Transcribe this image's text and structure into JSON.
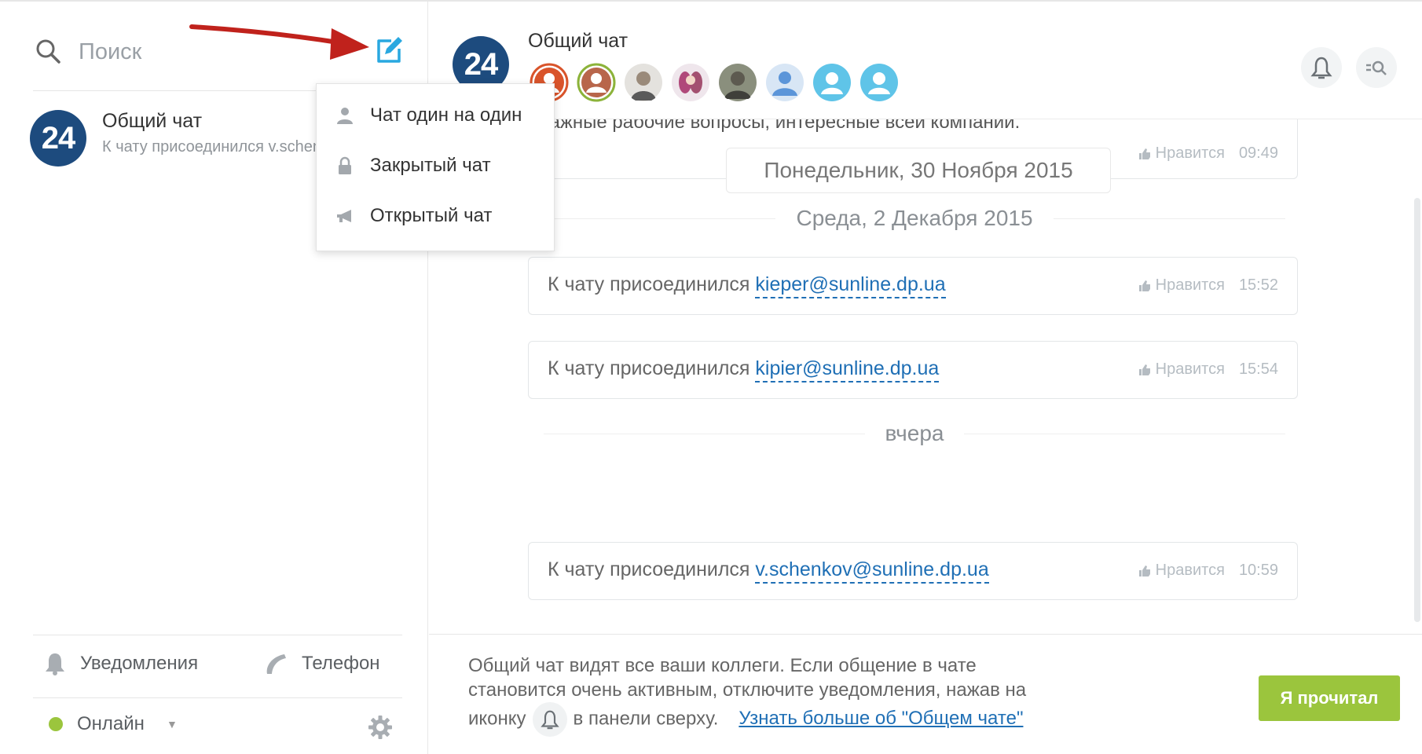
{
  "sidebar": {
    "search_placeholder": "Поиск",
    "chat": {
      "badge": "24",
      "name": "Общий чат",
      "preview": "К чату присоединился v.schenkov@sunline.dp.ua"
    },
    "notifications_label": "Уведомления",
    "phone_label": "Телефон",
    "status_label": "Онлайн",
    "status_color": "#9bc53d"
  },
  "menu": {
    "items": [
      {
        "label": "Чат один на один",
        "icon": "user-icon"
      },
      {
        "label": "Закрытый чат",
        "icon": "lock-icon"
      },
      {
        "label": "Открытый чат",
        "icon": "megaphone-icon"
      }
    ]
  },
  "header": {
    "badge": "24",
    "title": "Общий чат",
    "participant_count": 8
  },
  "messages": {
    "top_text": "важные рабочие вопросы, интересные всей компании.",
    "top_date_pill": "Понедельник, 30 Ноября 2015",
    "top_like": "Нравится",
    "top_time": "09:49",
    "sep1": "Среда, 2 Декабря 2015",
    "sep2": "вчера",
    "items": [
      {
        "text": "К чату присоединился ",
        "user": "kieper@sunline.dp.ua",
        "like": "Нравится",
        "time": "15:52"
      },
      {
        "text": "К чату присоединился ",
        "user": "kipier@sunline.dp.ua",
        "like": "Нравится",
        "time": "15:54"
      },
      {
        "text": "К чату присоединился ",
        "user": "v.schenkov@sunline.dp.ua",
        "like": "Нравится",
        "time": "10:59"
      }
    ]
  },
  "footer": {
    "info_line1": "Общий чат видят все ваши коллеги. Если общение в чате",
    "info_line2": "становится очень активным, отключите уведомления, нажав на",
    "info_line3a": "иконку",
    "info_line3b": "в панели сверху.",
    "learn_more": "Узнать больше об \"Общем чате\"",
    "read_button": "Я прочитал"
  },
  "colors": {
    "brand": "#1d4b7e",
    "accent": "#9bc53d",
    "link": "#1f6fb5",
    "compose": "#29a8e0",
    "arrow": "#c0221c"
  }
}
